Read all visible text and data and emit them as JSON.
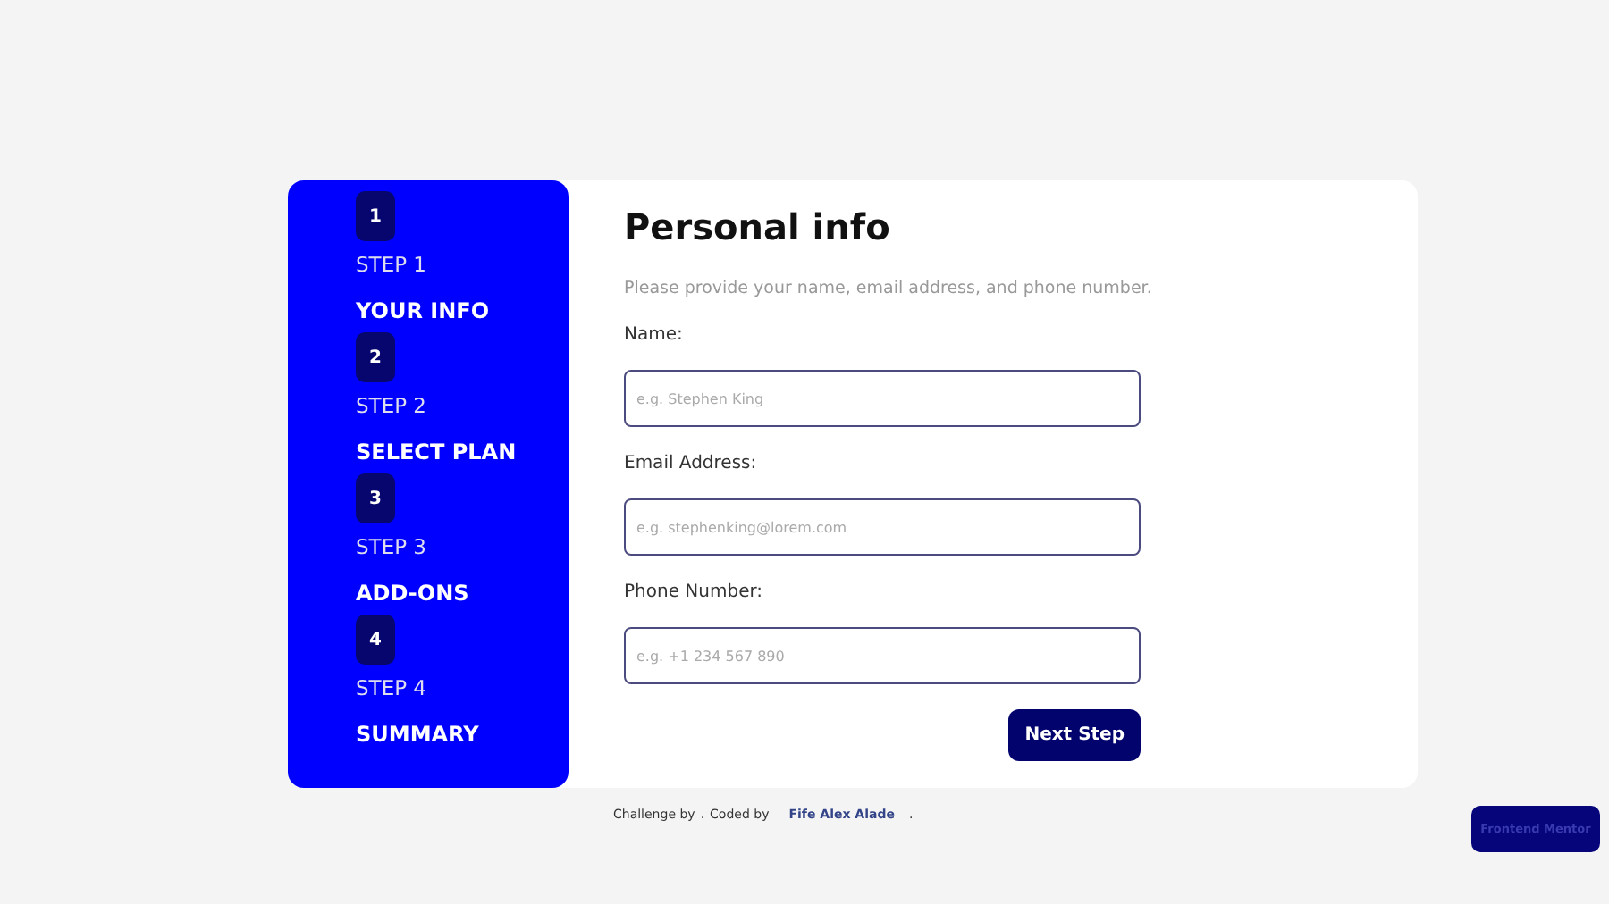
{
  "steps": [
    {
      "number": "1",
      "step": "STEP 1",
      "title": "YOUR INFO"
    },
    {
      "number": "2",
      "step": "STEP 2",
      "title": "SELECT PLAN"
    },
    {
      "number": "3",
      "step": "STEP 3",
      "title": "ADD-ONS"
    },
    {
      "number": "4",
      "step": "STEP 4",
      "title": "SUMMARY"
    }
  ],
  "form": {
    "title": "Personal info",
    "subtitle": "Please provide your name, email address, and phone number.",
    "fields": [
      {
        "label": "Name:",
        "placeholder": "e.g. Stephen King"
      },
      {
        "label": "Email Address:",
        "placeholder": "e.g. stephenking@lorem.com"
      },
      {
        "label": "Phone Number:",
        "placeholder": "e.g. +1 234 567 890"
      }
    ],
    "button": "Next Step"
  },
  "footer": {
    "prefix": "Challenge by",
    "dot_1": ".",
    "middle": "Coded by",
    "author": "Fife Alex Alade",
    "dot_2": ".",
    "badge": "Frontend Mentor"
  }
}
